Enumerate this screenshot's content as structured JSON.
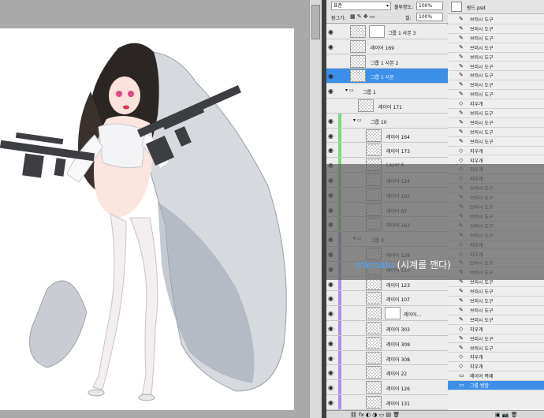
{
  "layers_panel": {
    "blend_mode": "표준",
    "opacity_label": "불투명도:",
    "opacity_value": "100%",
    "lock_label": "잠그기:",
    "fill_label": "칠:",
    "fill_value": "100%",
    "layers": [
      {
        "name": "그룹 1 사본 3",
        "visible": true,
        "indent": 0,
        "kind": "mask",
        "group_color": null
      },
      {
        "name": "레이어 169",
        "visible": true,
        "indent": 0,
        "kind": "plain",
        "group_color": null
      },
      {
        "name": "그룹 1 사본 2",
        "visible": false,
        "indent": 0,
        "kind": "image",
        "group_color": null
      },
      {
        "name": "그룹 1 사본",
        "visible": true,
        "indent": 0,
        "kind": "image",
        "selected": true,
        "group_color": null
      },
      {
        "name": "그룹 1",
        "visible": true,
        "indent": 0,
        "kind": "group",
        "group_color": null
      },
      {
        "name": "레이어 171",
        "visible": false,
        "indent": 1,
        "kind": "plain",
        "group_color": null
      },
      {
        "name": "그룹 10",
        "visible": true,
        "indent": 1,
        "kind": "group",
        "group_color": "#7ed67e"
      },
      {
        "name": "레이어 164",
        "visible": true,
        "indent": 2,
        "kind": "plain",
        "group_color": "#7ed67e"
      },
      {
        "name": "레이어 173",
        "visible": true,
        "indent": 2,
        "kind": "plain",
        "group_color": "#7ed67e"
      },
      {
        "name": "Layer 6",
        "visible": true,
        "indent": 2,
        "kind": "plain",
        "group_color": "#7ed67e"
      },
      {
        "name": "레이어 124",
        "visible": true,
        "indent": 2,
        "kind": "plain",
        "group_color": "#7ed67e"
      },
      {
        "name": "레이어 162",
        "visible": true,
        "indent": 2,
        "kind": "plain",
        "group_color": "#7ed67e"
      },
      {
        "name": "레이어 87",
        "visible": true,
        "indent": 2,
        "kind": "plain",
        "group_color": "#7ed67e"
      },
      {
        "name": "레이어 163",
        "visible": true,
        "indent": 2,
        "kind": "plain",
        "group_color": "#7ed67e"
      },
      {
        "name": "그룹 3",
        "visible": true,
        "indent": 1,
        "kind": "group",
        "group_color": "#b48be8"
      },
      {
        "name": "레이어 128",
        "visible": true,
        "indent": 2,
        "kind": "plain",
        "group_color": "#b48be8"
      },
      {
        "name": "레이어 110",
        "visible": true,
        "indent": 2,
        "kind": "plain",
        "group_color": "#b48be8"
      },
      {
        "name": "레이어 123",
        "visible": true,
        "indent": 2,
        "kind": "plain",
        "group_color": "#b48be8"
      },
      {
        "name": "레이어 107",
        "visible": true,
        "indent": 2,
        "kind": "plain",
        "group_color": "#b48be8"
      },
      {
        "name": "레이어...",
        "visible": true,
        "indent": 2,
        "kind": "mask",
        "group_color": "#b48be8"
      },
      {
        "name": "레이어 303",
        "visible": true,
        "indent": 2,
        "kind": "plain",
        "group_color": "#b48be8"
      },
      {
        "name": "레이어 309",
        "visible": true,
        "indent": 2,
        "kind": "plain",
        "group_color": "#b48be8"
      },
      {
        "name": "레이어 308",
        "visible": true,
        "indent": 2,
        "kind": "plain",
        "group_color": "#b48be8"
      },
      {
        "name": "레이어 22",
        "visible": true,
        "indent": 2,
        "kind": "plain",
        "group_color": "#b48be8"
      },
      {
        "name": "레이어 126",
        "visible": true,
        "indent": 2,
        "kind": "plain",
        "group_color": "#b48be8"
      },
      {
        "name": "레이어 131",
        "visible": true,
        "indent": 2,
        "kind": "plain",
        "group_color": "#b48be8"
      }
    ]
  },
  "history_panel": {
    "document": "원드.psd",
    "items": [
      "브러시 도구",
      "브러시 도구",
      "브러시 도구",
      "브러시 도구",
      "브러시 도구",
      "브러시 도구",
      "브러시 도구",
      "브러시 도구",
      "브러시 도구",
      "지우개",
      "브러시 도구",
      "브러시 도구",
      "브러시 도구",
      "브러시 도구",
      "지우개",
      "지우개",
      "지우개",
      "지우개",
      "브러시 도구",
      "브러시 도구",
      "브러시 도구",
      "브러시 도구",
      "브러시 도구",
      "브러시 도구",
      "지우개",
      "지우개",
      "브러시 도구",
      "브러시 도구",
      "브러시 도구",
      "브러시 도구",
      "브러시 도구",
      "브러시 도구",
      "브러시 도구",
      "지우개",
      "브러시 도구",
      "브러시 도구",
      "지우개",
      "지우개",
      "레이어 복제",
      "그룹 병합"
    ]
  },
  "caption": {
    "nickname": "mkmalu",
    "message": " (시계를 깬다)"
  }
}
